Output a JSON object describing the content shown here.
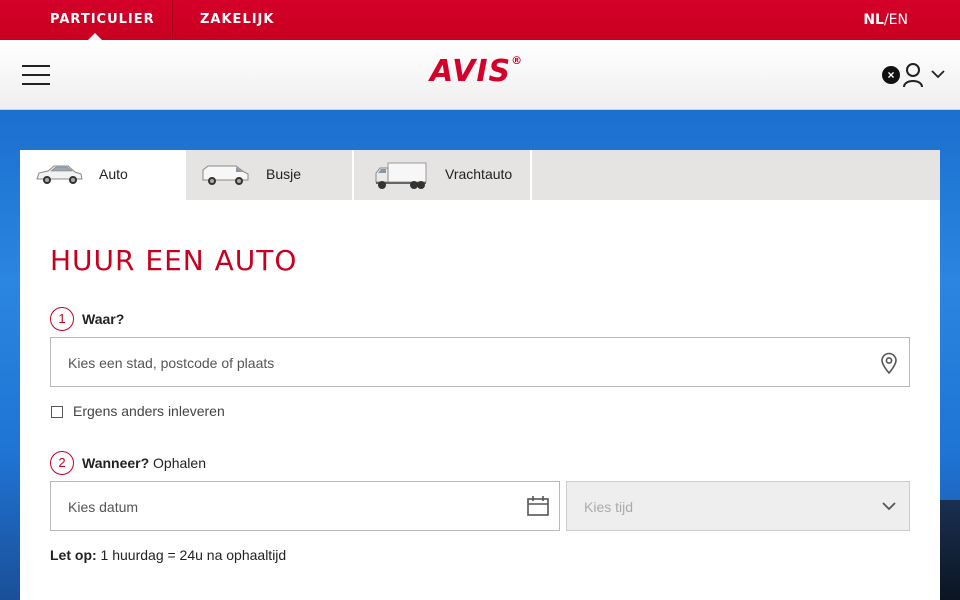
{
  "topbar": {
    "segment_particulier": "PARTICULIER",
    "segment_zakelijk": "ZAKELIJK",
    "lang_nl": "NL",
    "lang_sep": "/",
    "lang_en": "EN"
  },
  "header": {
    "logo_text": "AVIS",
    "logo_mark": "®",
    "close_icon": "×"
  },
  "tabs": [
    {
      "label": "Auto",
      "icon": "car-icon",
      "active": true
    },
    {
      "label": "Busje",
      "icon": "van-icon",
      "active": false
    },
    {
      "label": "Vrachtauto",
      "icon": "truck-icon",
      "active": false
    }
  ],
  "form": {
    "title": "HUUR EEN AUTO",
    "step1": {
      "number": "1",
      "label": "Waar?"
    },
    "location_placeholder": "Kies een stad, postcode of plaats",
    "return_elsewhere_label": "Ergens anders inleveren",
    "step2": {
      "number": "2",
      "label": "Wanneer?",
      "sublabel": "Ophalen"
    },
    "date_placeholder": "Kies datum",
    "time_placeholder": "Kies tijd",
    "note_bold": "Let op:",
    "note_text": "1 huurdag = 24u na ophaaltijd"
  },
  "colors": {
    "brand_red": "#d4002a",
    "background_blue": "#2a86e0"
  }
}
